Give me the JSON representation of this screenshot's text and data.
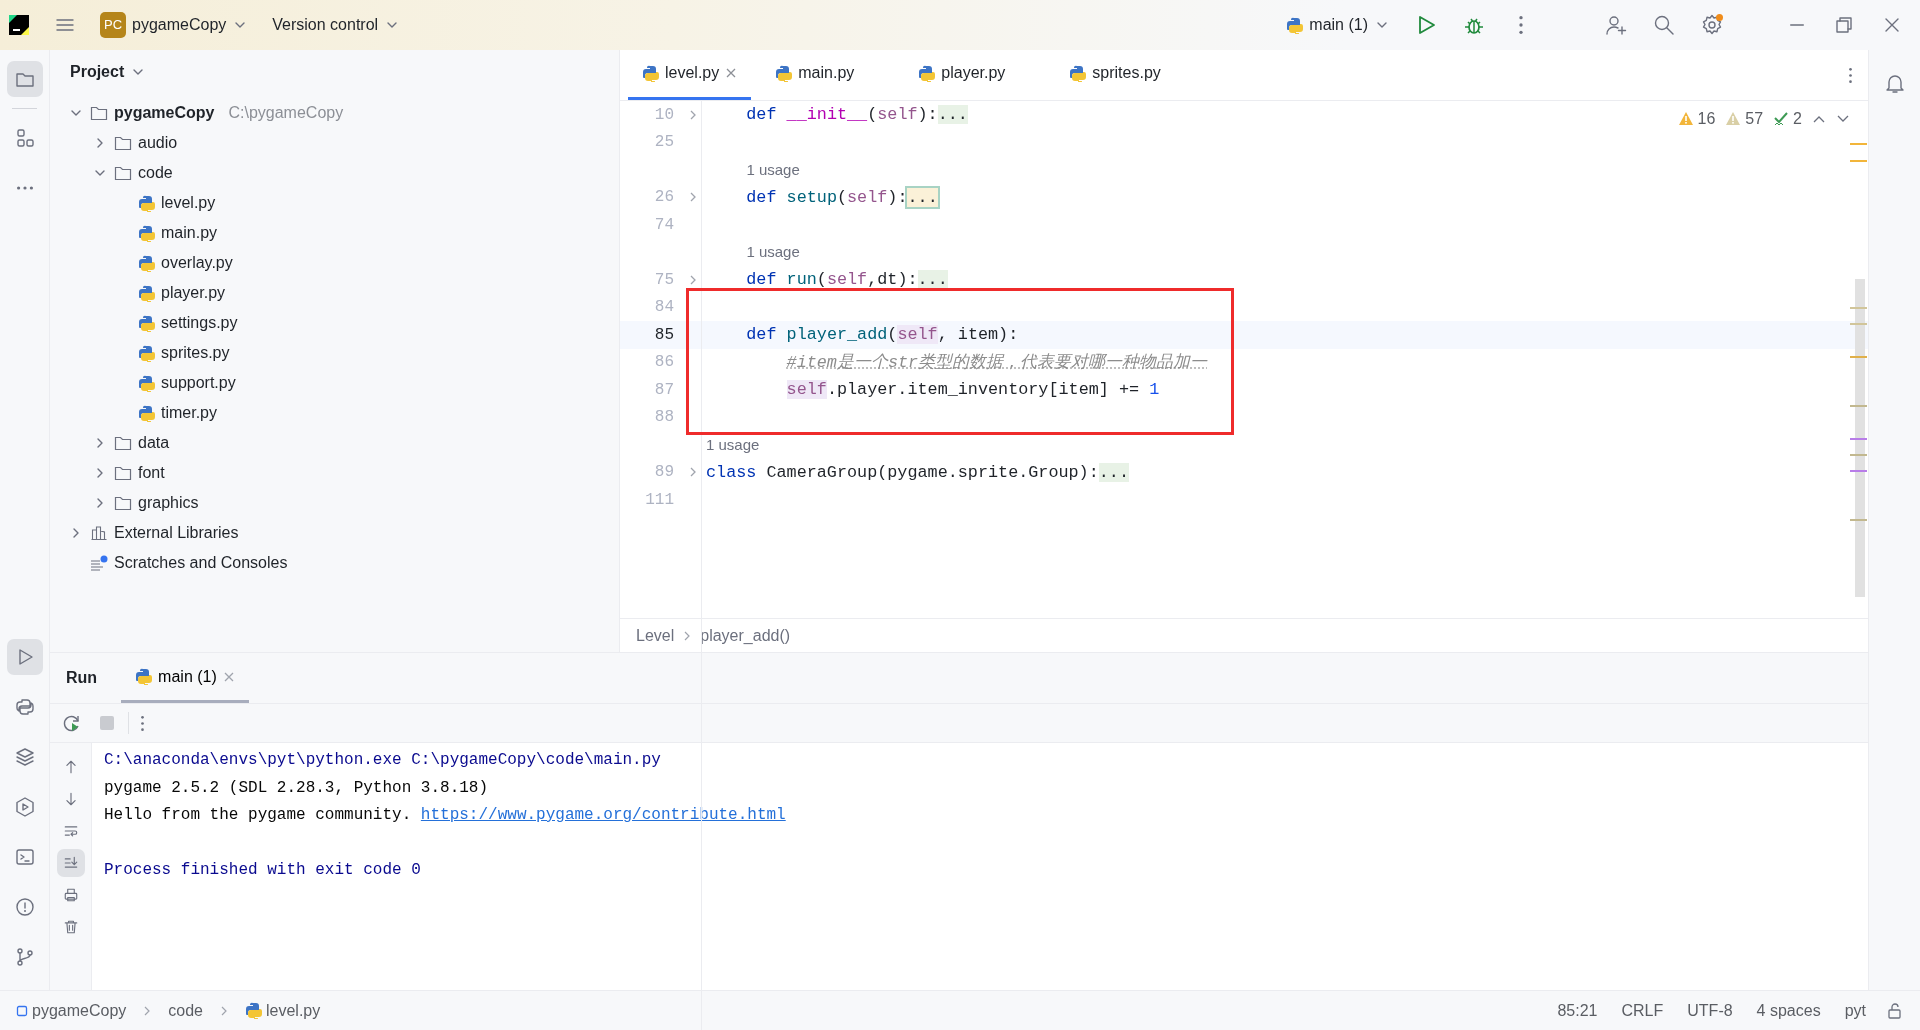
{
  "title_bar": {
    "project_badge": "PC",
    "project": "pygameCopy",
    "vcs": "Version control",
    "run_config": "main (1)"
  },
  "left_toolbar": {
    "top": [
      {
        "kind": "project",
        "selected": true
      },
      {
        "kind": "structure",
        "selected": false
      },
      {
        "kind": "more",
        "selected": false
      }
    ],
    "bottom": [
      {
        "kind": "run",
        "selected": true
      },
      {
        "kind": "python-console",
        "selected": false
      },
      {
        "kind": "layers",
        "selected": false
      },
      {
        "kind": "services",
        "selected": false
      },
      {
        "kind": "terminal",
        "selected": false
      },
      {
        "kind": "problems",
        "selected": false
      },
      {
        "kind": "git",
        "selected": false
      }
    ]
  },
  "project_panel": {
    "title": "Project",
    "tree": [
      {
        "kind": "root",
        "label": "pygameCopy",
        "path": "C:\\pygameCopy",
        "expanded": true,
        "children": [
          {
            "kind": "folder",
            "label": "audio",
            "expanded": false
          },
          {
            "kind": "folder",
            "label": "code",
            "expanded": true,
            "children": [
              {
                "kind": "python",
                "label": "level.py"
              },
              {
                "kind": "python",
                "label": "main.py"
              },
              {
                "kind": "python",
                "label": "overlay.py"
              },
              {
                "kind": "python",
                "label": "player.py"
              },
              {
                "kind": "python",
                "label": "settings.py"
              },
              {
                "kind": "python",
                "label": "sprites.py"
              },
              {
                "kind": "python",
                "label": "support.py"
              },
              {
                "kind": "python",
                "label": "timer.py"
              }
            ]
          },
          {
            "kind": "folder",
            "label": "data",
            "expanded": false
          },
          {
            "kind": "folder",
            "label": "font",
            "expanded": false
          },
          {
            "kind": "folder",
            "label": "graphics",
            "expanded": false
          }
        ]
      },
      {
        "kind": "library",
        "label": "External Libraries",
        "expanded": false
      },
      {
        "kind": "scratches",
        "label": "Scratches and Consoles"
      }
    ]
  },
  "editor": {
    "tabs": [
      {
        "label": "level.py",
        "selected": true,
        "closable": true
      },
      {
        "label": "main.py",
        "selected": false,
        "closable": false
      },
      {
        "label": "player.py",
        "selected": false,
        "closable": false
      },
      {
        "label": "sprites.py",
        "selected": false,
        "closable": false
      }
    ],
    "inspections": [
      {
        "kind": "warning",
        "count": "16"
      },
      {
        "kind": "weak-warning",
        "count": "57"
      },
      {
        "kind": "typo",
        "count": "2"
      }
    ],
    "rows": [
      {
        "kind": "code",
        "number": "10",
        "folded": true,
        "current": false,
        "boxed": false,
        "tokens": [
          {
            "text": "    def ",
            "kind": "keyword"
          },
          {
            "text": "__init__",
            "kind": "magic"
          },
          {
            "text": "(",
            "kind": "plain"
          },
          {
            "text": "self",
            "kind": "self"
          },
          {
            "text": "):",
            "kind": "plain"
          },
          {
            "text": "...",
            "kind": "fold"
          }
        ]
      },
      {
        "kind": "code",
        "number": "25",
        "folded": false,
        "current": false,
        "boxed": false
      },
      {
        "kind": "usage",
        "text": "1 usage"
      },
      {
        "kind": "code",
        "number": "26",
        "folded": true,
        "current": false,
        "boxed": false,
        "tokens": [
          {
            "text": "    def ",
            "kind": "keyword"
          },
          {
            "text": "setup",
            "kind": "function"
          },
          {
            "text": "(",
            "kind": "plain"
          },
          {
            "text": "self",
            "kind": "self"
          },
          {
            "text": "):",
            "kind": "plain"
          },
          {
            "text": "...",
            "kind": "fold-match"
          }
        ]
      },
      {
        "kind": "code",
        "number": "74",
        "folded": false,
        "current": false,
        "boxed": false
      },
      {
        "kind": "usage",
        "text": "1 usage"
      },
      {
        "kind": "code",
        "number": "75",
        "folded": true,
        "current": false,
        "boxed": false,
        "tokens": [
          {
            "text": "    def ",
            "kind": "keyword"
          },
          {
            "text": "run",
            "kind": "function"
          },
          {
            "text": "(",
            "kind": "plain"
          },
          {
            "text": "self",
            "kind": "self"
          },
          {
            "text": ",dt):",
            "kind": "plain"
          },
          {
            "text": "...",
            "kind": "fold"
          }
        ]
      },
      {
        "kind": "code",
        "number": "84",
        "folded": false,
        "current": false,
        "boxed": true
      },
      {
        "kind": "code",
        "number": "85",
        "folded": false,
        "current": true,
        "boxed": true,
        "tokens": [
          {
            "text": "    def ",
            "kind": "keyword"
          },
          {
            "text": "player_add",
            "kind": "function"
          },
          {
            "text": "(",
            "kind": "plain"
          },
          {
            "text": "self",
            "kind": "self-highlight"
          },
          {
            "text": ", item):",
            "kind": "plain"
          }
        ]
      },
      {
        "kind": "code",
        "number": "86",
        "folded": false,
        "current": false,
        "boxed": true,
        "tokens": [
          {
            "text": "        #item是一个str类型的数据，代表要对哪一种物品加一",
            "kind": "comment"
          }
        ]
      },
      {
        "kind": "code",
        "number": "87",
        "folded": false,
        "current": false,
        "boxed": true,
        "tokens": [
          {
            "text": "        self",
            "kind": "self-highlight"
          },
          {
            "text": ".player.item_inventory[item] += ",
            "kind": "plain"
          },
          {
            "text": "1",
            "kind": "number"
          }
        ]
      },
      {
        "kind": "code",
        "number": "88",
        "folded": false,
        "current": false,
        "boxed": true
      },
      {
        "kind": "usage",
        "text": "1 usage"
      },
      {
        "kind": "code",
        "number": "89",
        "folded": true,
        "current": false,
        "boxed": false,
        "tokens": [
          {
            "text": "class ",
            "kind": "keyword"
          },
          {
            "text": "CameraGroup(pygame.sprite.Group):",
            "kind": "plain"
          },
          {
            "text": "...",
            "kind": "fold"
          }
        ]
      },
      {
        "kind": "code",
        "number": "111",
        "folded": false,
        "current": false,
        "boxed": false
      }
    ],
    "breadcrumb": [
      "Level",
      "player_add()"
    ]
  },
  "run_panel": {
    "title": "Run",
    "tabs": [
      {
        "label": "main (1)",
        "selected": true
      }
    ],
    "side_tools": [
      {
        "kind": "up",
        "selected": false
      },
      {
        "kind": "down",
        "selected": false
      },
      {
        "kind": "wrap",
        "selected": false
      },
      {
        "kind": "scroll-end",
        "selected": true
      },
      {
        "kind": "print",
        "selected": false
      },
      {
        "kind": "clear",
        "selected": false
      }
    ],
    "console": [
      {
        "kind": "system",
        "text": "C:\\anaconda\\envs\\pyt\\python.exe C:\\pygameCopy\\code\\main.py"
      },
      {
        "kind": "output",
        "text": "pygame 2.5.2 (SDL 2.28.3, Python 3.8.18)"
      },
      {
        "kind": "output",
        "text": "Hello from the pygame community. ",
        "link": "https://www.pygame.org/contribute.html"
      },
      {
        "kind": "blank"
      },
      {
        "kind": "system",
        "text": "Process finished with exit code 0"
      }
    ]
  },
  "status_bar": {
    "breadcrumb": [
      {
        "kind": "project",
        "label": "pygameCopy"
      },
      {
        "kind": "folder",
        "label": "code"
      },
      {
        "kind": "python",
        "label": "level.py"
      }
    ],
    "items": [
      "85:21",
      "CRLF",
      "UTF-8",
      "4 spaces",
      "pyt"
    ]
  }
}
